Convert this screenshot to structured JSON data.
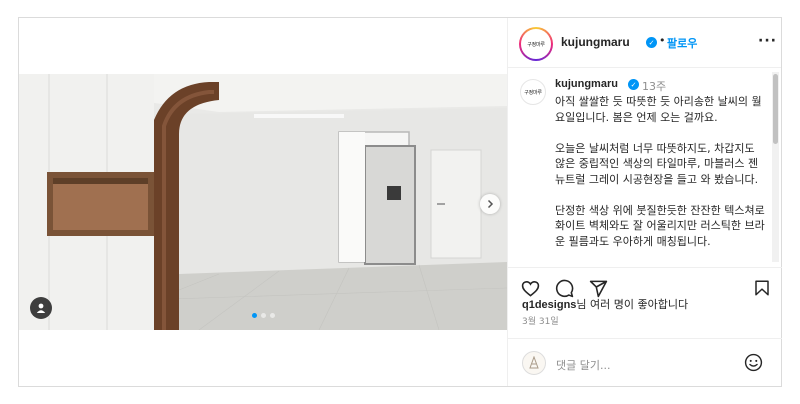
{
  "post": {
    "header": {
      "avatar_text": "구정마루",
      "username": "kujungmaru",
      "separator": "•",
      "follow_label": "팔로우",
      "more_label": "···"
    },
    "caption": {
      "username": "kujungmaru",
      "time": "13주",
      "paragraphs": [
        "아직 쌀쌀한 듯 따뜻한 듯 아리송한 날씨의 월요일입니다. 봄은 언제 오는 걸까요.",
        "오늘은 날씨처럼 너무 따뜻하지도, 차갑지도 않은 중립적인 색상의 타일마루, 마블러스 젠 뉴트럴 그레이 시공현장을 들고 와 봤습니다.",
        "단정한 색상 위에 붓질한듯한 잔잔한 텍스쳐로 화이트 벽체와도 잘 어울리지만 러스틱한 브라운 필름과도 우아하게 매칭됩니다."
      ]
    },
    "likes": {
      "user": "q1designs",
      "suffix": "님 여러 명이 좋아합니다"
    },
    "date": "3월 31일",
    "comment": {
      "placeholder": "댓글 달기..."
    },
    "icons": {
      "carousel_next": "chevron-right-icon",
      "tag": "user-tag-icon",
      "like": "heart-icon",
      "comment": "comment-icon",
      "share": "paper-plane-icon",
      "save": "bookmark-icon",
      "emoji": "smiley-icon",
      "verified": "verified-badge-icon"
    },
    "carousel": {
      "slide_count": 3,
      "active_index": 0
    },
    "colors": {
      "accent": "#0095f6",
      "text": "#262626",
      "muted": "#8e8e8e"
    }
  }
}
